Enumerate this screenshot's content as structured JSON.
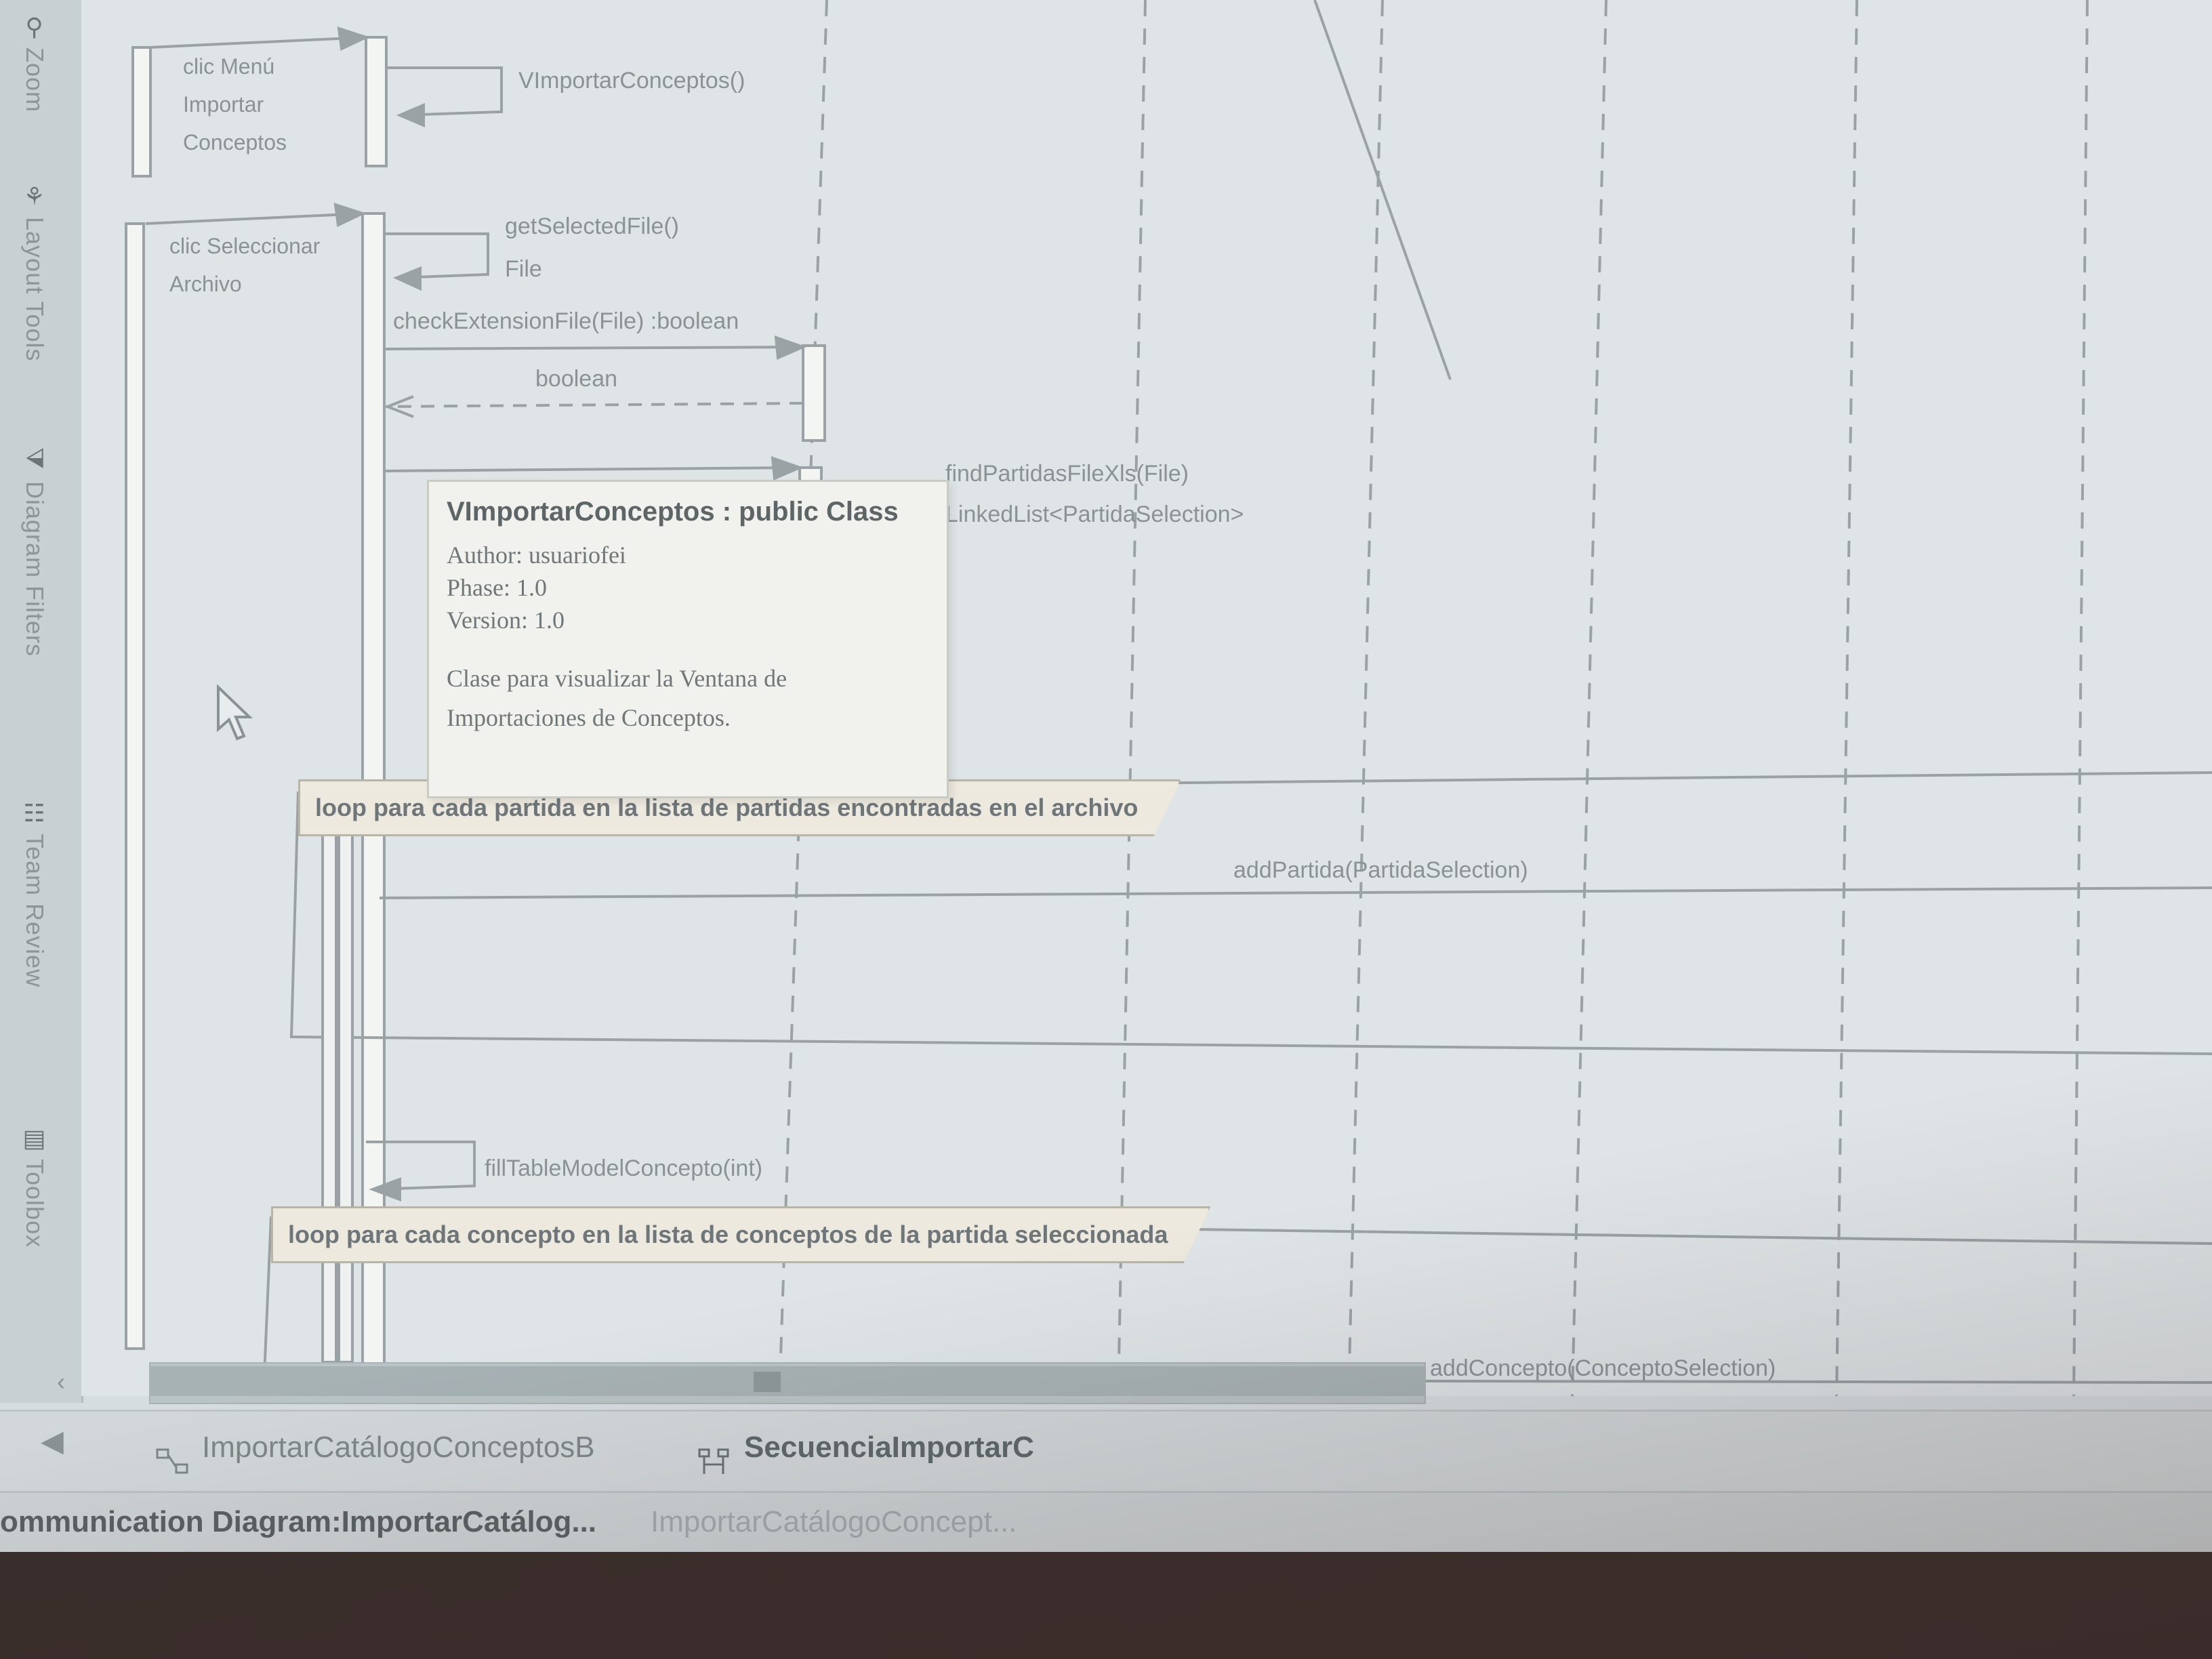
{
  "side_toolbar": {
    "items": [
      {
        "label": "Zoom",
        "icon": "zoom-icon"
      },
      {
        "label": "Layout Tools",
        "icon": "layout-tools-icon"
      },
      {
        "label": "Diagram Filters",
        "icon": "diagram-filters-icon"
      },
      {
        "label": "Team Review",
        "icon": "team-review-icon"
      },
      {
        "label": "Toolbox",
        "icon": "toolbox-icon"
      }
    ]
  },
  "diagram": {
    "notes": {
      "menu_click": "clic Menú Importar Conceptos",
      "select_file": "clic Seleccionar Archivo"
    },
    "messages": {
      "m1": "VImportarConceptos()",
      "m2": "getSelectedFile()",
      "m2_return": "File",
      "m3": "checkExtensionFile(File) :boolean",
      "m3_return": "boolean",
      "m4": "findPartidasFileXls(File)",
      "m4_return": "LinkedList<PartidaSelection>",
      "m5": "addPartida(PartidaSelection)",
      "m6": "fillTableModelConcepto(int)",
      "m7": "addConcepto(ConceptoSelection)"
    },
    "loops": {
      "loop1": "loop para cada partida en la lista de partidas encontradas en el archivo",
      "loop2": "loop para cada concepto en la lista de conceptos de la partida seleccionada"
    }
  },
  "tooltip": {
    "title": "VImportarConceptos : public Class",
    "author": "Author: usuariofei",
    "phase": "Phase: 1.0",
    "version": "Version: 1.0",
    "description": "Clase para visualizar la Ventana de Importaciones de Conceptos."
  },
  "tabs": {
    "nav_left": "◀",
    "items": [
      {
        "label": "ImportarCatálogoConceptosB",
        "icon": "communication-diagram-icon",
        "active": false
      },
      {
        "label": "SecuenciaImportarC",
        "icon": "sequence-diagram-icon",
        "active": true
      }
    ]
  },
  "status_bar": {
    "left": "ommunication Diagram:ImportarCatálog...",
    "right": "ImportarCatálogoConcept..."
  },
  "colors": {
    "canvas": "#dfe5e7",
    "lines": "#9aa2a5",
    "frame_fill": "#ede9df"
  }
}
